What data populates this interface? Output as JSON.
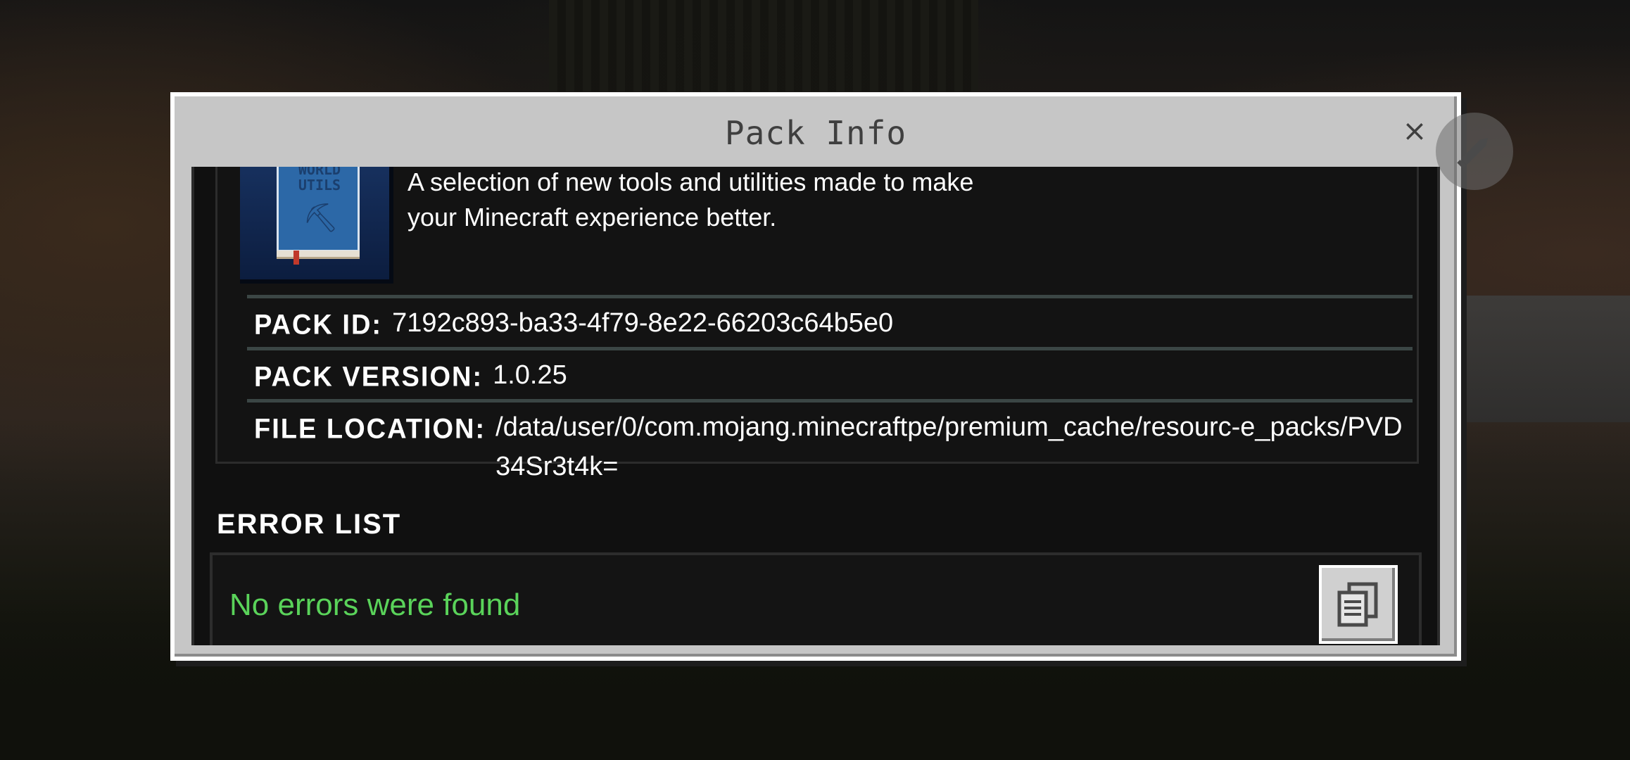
{
  "dialog": {
    "title": "Pack Info",
    "close_label": "×"
  },
  "pack": {
    "icon_text": "WORLD UTILS",
    "description_line1": "A selection of new tools and utilities made to make",
    "description_line2": "your Minecraft experience better.",
    "pack_id_label": "PACK ID:",
    "pack_id_value": "7192c893-ba33-4f79-8e22-66203c64b5e0",
    "pack_version_label": "PACK VERSION:",
    "pack_version_value": "1.0.25",
    "file_location_label": "FILE LOCATION:",
    "file_location_value": "/data/user/0/com.mojang.minecraftpe/premium_cache/resourc-e_packs/PVD34Sr3t4k="
  },
  "errors": {
    "title": "ERROR LIST",
    "message": "No errors were found"
  },
  "icons": {
    "close": "close-icon",
    "edit": "pencil-icon",
    "copy": "clipboard-copy-icon"
  },
  "colors": {
    "dialog_bg": "#c6c6c6",
    "content_bg": "#101010",
    "success_text": "#5ad35a"
  }
}
